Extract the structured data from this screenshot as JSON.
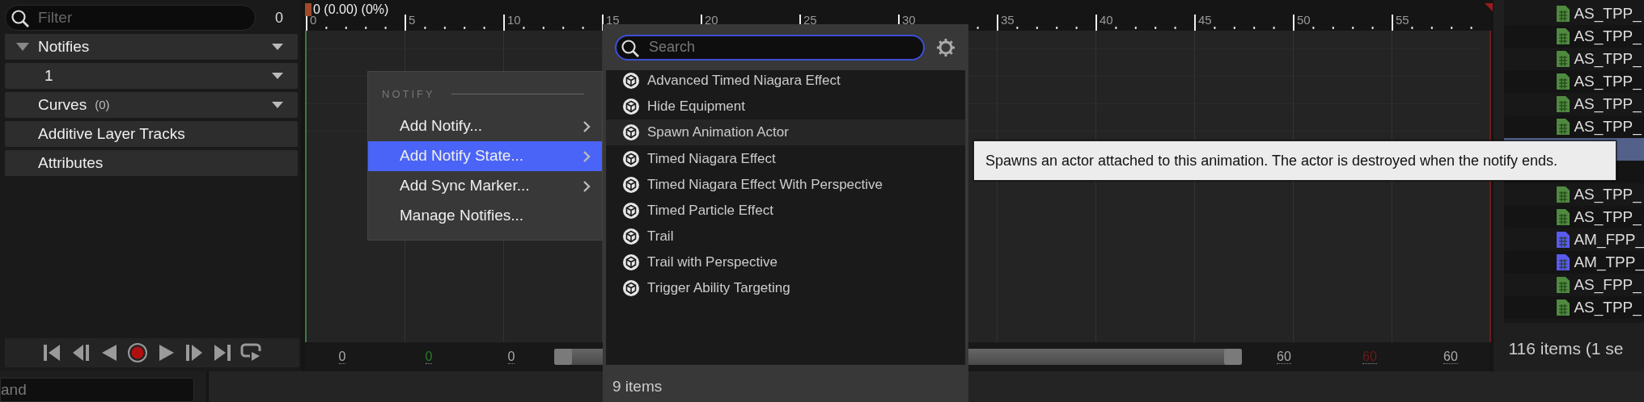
{
  "outliner": {
    "filter": {
      "placeholder": "Filter"
    },
    "count": "0",
    "tracks": [
      {
        "label": "Notifies",
        "kind": "group"
      },
      {
        "label": "1",
        "kind": "track"
      },
      {
        "label": "Curves",
        "count": "(0)",
        "kind": "track"
      },
      {
        "label": "Additive Layer Tracks",
        "kind": "plain"
      },
      {
        "label": "Attributes",
        "kind": "plain"
      }
    ]
  },
  "timeline": {
    "position": "0 (0.00) (0%)",
    "ticks": [
      "0",
      "5",
      "10",
      "15",
      "20",
      "25",
      "30",
      "35",
      "40",
      "45",
      "50",
      "55"
    ],
    "range_start": [
      {
        "value": "0",
        "kind": "bound"
      },
      {
        "value": "0",
        "kind": "playback-start"
      },
      {
        "value": "0",
        "kind": "bound"
      }
    ],
    "range_end": [
      {
        "value": "60",
        "kind": "bound"
      },
      {
        "value": "60",
        "kind": "playback-end"
      },
      {
        "value": "60",
        "kind": "bound"
      }
    ]
  },
  "context_menu": {
    "header": "NOTIFY",
    "items": [
      {
        "label": "Add Notify...",
        "submenu": true,
        "selected": false
      },
      {
        "label": "Add Notify State...",
        "submenu": true,
        "selected": true
      },
      {
        "label": "Add Sync Marker...",
        "submenu": true,
        "selected": false
      },
      {
        "label": "Manage Notifies...",
        "submenu": false,
        "selected": false
      }
    ]
  },
  "submenu": {
    "search": {
      "placeholder": "Search"
    },
    "items": [
      {
        "label": "Advanced Timed Niagara Effect",
        "hovered": false
      },
      {
        "label": "Hide Equipment",
        "hovered": false
      },
      {
        "label": "Spawn Animation Actor",
        "hovered": true
      },
      {
        "label": "Timed Niagara Effect",
        "hovered": false
      },
      {
        "label": "Timed Niagara Effect With Perspective",
        "hovered": false
      },
      {
        "label": "Timed Particle Effect",
        "hovered": false
      },
      {
        "label": "Trail",
        "hovered": false
      },
      {
        "label": "Trail with Perspective",
        "hovered": false
      },
      {
        "label": "Trigger Ability Targeting",
        "hovered": false
      }
    ],
    "count": "9 items"
  },
  "tooltip": {
    "text": "Spawns an actor attached to this animation. The actor is destroyed when the notify ends."
  },
  "asset_list": {
    "items": [
      {
        "label": "AS_TPP_",
        "color": "#4f8a3f",
        "selected": false
      },
      {
        "label": "AS_TPP_",
        "color": "#4f8a3f",
        "selected": false
      },
      {
        "label": "AS_TPP_",
        "color": "#4f8a3f",
        "selected": false
      },
      {
        "label": "AS_TPP_",
        "color": "#4f8a3f",
        "selected": false
      },
      {
        "label": "AS_TPP_",
        "color": "#4f8a3f",
        "selected": false
      },
      {
        "label": "AS_TPP_",
        "color": "#4f8a3f",
        "selected": false
      },
      {
        "selected": true
      },
      {
        "selected": false
      },
      {
        "label": "AS_TPP_",
        "color": "#4f8a3f",
        "selected": false
      },
      {
        "label": "AS_TPP_",
        "color": "#4f8a3f",
        "selected": false
      },
      {
        "label": "AM_FPP_",
        "color": "#5a5af0",
        "selected": false
      },
      {
        "label": "AM_TPP_",
        "color": "#5a5af0",
        "selected": false
      },
      {
        "label": "AS_FPP_",
        "color": "#4f8a3f",
        "selected": false
      },
      {
        "label": "AS_TPP_",
        "color": "#4f8a3f",
        "selected": false
      }
    ],
    "status": "116 items (1 se"
  },
  "console": {
    "placeholder": "and"
  }
}
